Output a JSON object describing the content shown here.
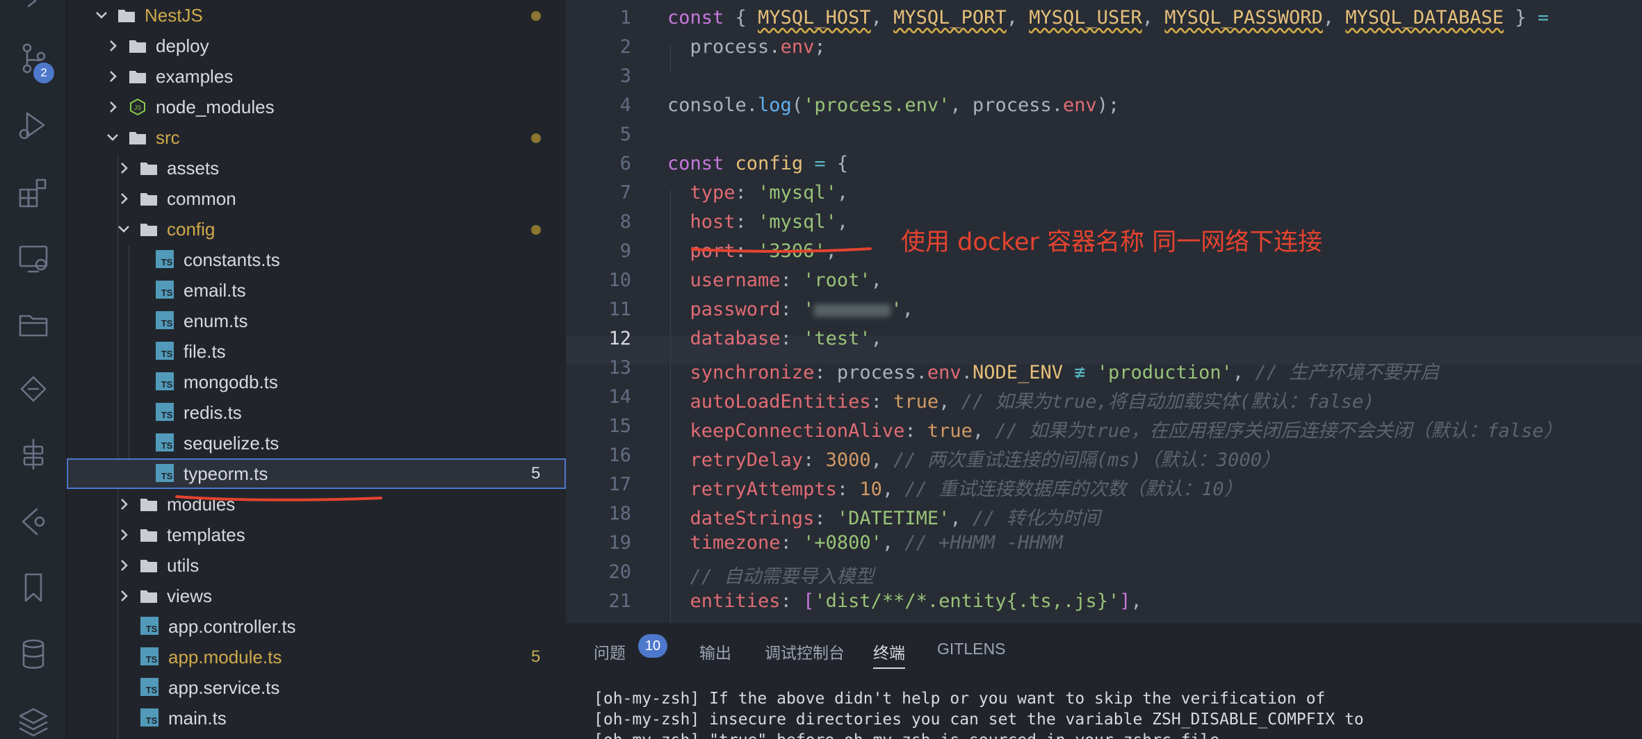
{
  "activity_bar": {
    "scm_badge": "2"
  },
  "explorer": {
    "tree": [
      {
        "label": "NestJS",
        "kind": "folder-open",
        "depth": 0,
        "modified": true,
        "mark": "dot"
      },
      {
        "label": "deploy",
        "kind": "folder",
        "depth": 1
      },
      {
        "label": "examples",
        "kind": "folder",
        "depth": 1
      },
      {
        "label": "node_modules",
        "kind": "node",
        "depth": 1
      },
      {
        "label": "src",
        "kind": "folder-open",
        "depth": 1,
        "modified": true,
        "mark": "dot"
      },
      {
        "label": "assets",
        "kind": "folder",
        "depth": 2
      },
      {
        "label": "common",
        "kind": "folder",
        "depth": 2
      },
      {
        "label": "config",
        "kind": "folder-open",
        "depth": 2,
        "modified": true,
        "mark": "dot"
      },
      {
        "label": "constants.ts",
        "kind": "ts",
        "depth": 3
      },
      {
        "label": "email.ts",
        "kind": "ts",
        "depth": 3
      },
      {
        "label": "enum.ts",
        "kind": "ts",
        "depth": 3
      },
      {
        "label": "file.ts",
        "kind": "ts",
        "depth": 3
      },
      {
        "label": "mongodb.ts",
        "kind": "ts",
        "depth": 3
      },
      {
        "label": "redis.ts",
        "kind": "ts",
        "depth": 3
      },
      {
        "label": "sequelize.ts",
        "kind": "ts",
        "depth": 3
      },
      {
        "label": "typeorm.ts",
        "kind": "ts",
        "depth": 3,
        "selected": true,
        "count": "5"
      },
      {
        "label": "modules",
        "kind": "folder",
        "depth": 2
      },
      {
        "label": "templates",
        "kind": "folder",
        "depth": 2
      },
      {
        "label": "utils",
        "kind": "folder",
        "depth": 2
      },
      {
        "label": "views",
        "kind": "folder",
        "depth": 2
      },
      {
        "label": "app.controller.ts",
        "kind": "ts",
        "depth": 2
      },
      {
        "label": "app.module.ts",
        "kind": "ts",
        "depth": 2,
        "modified": true,
        "count": "5"
      },
      {
        "label": "app.service.ts",
        "kind": "ts",
        "depth": 2
      },
      {
        "label": "main.ts",
        "kind": "ts",
        "depth": 2
      }
    ]
  },
  "editor": {
    "current_line": 12,
    "lines": [
      {
        "n": "1",
        "t": [
          [
            "k",
            "const "
          ],
          [
            "w",
            "{ "
          ],
          [
            "v squig",
            "MYSQL_HOST"
          ],
          [
            "w",
            ", "
          ],
          [
            "v squig",
            "MYSQL_PORT"
          ],
          [
            "w",
            ", "
          ],
          [
            "v squig",
            "MYSQL_USER"
          ],
          [
            "w",
            ", "
          ],
          [
            "v squig",
            "MYSQL_PASSWORD"
          ],
          [
            "w",
            ", "
          ],
          [
            "v squig",
            "MYSQL_DATABASE"
          ],
          [
            "w",
            " } "
          ],
          [
            "o",
            "="
          ]
        ]
      },
      {
        "n": "2",
        "t": [
          [
            "w",
            "  process."
          ],
          [
            "p",
            "env"
          ],
          [
            "w",
            ";"
          ]
        ]
      },
      {
        "n": "3",
        "t": []
      },
      {
        "n": "4",
        "t": [
          [
            "w",
            "console."
          ],
          [
            "f",
            "log"
          ],
          [
            "w",
            "("
          ],
          [
            "s",
            "'process.env'"
          ],
          [
            "w",
            ", process."
          ],
          [
            "p",
            "env"
          ],
          [
            "w",
            ");"
          ]
        ]
      },
      {
        "n": "5",
        "t": []
      },
      {
        "n": "6",
        "t": [
          [
            "k",
            "const "
          ],
          [
            "v",
            "config"
          ],
          [
            "o",
            " = "
          ],
          [
            "w",
            "{"
          ]
        ]
      },
      {
        "n": "7",
        "t": [
          [
            "p",
            "  type"
          ],
          [
            "w",
            ": "
          ],
          [
            "s",
            "'mysql'"
          ],
          [
            "w",
            ","
          ]
        ]
      },
      {
        "n": "8",
        "t": [
          [
            "p",
            "  host"
          ],
          [
            "w",
            ": "
          ],
          [
            "s",
            "'mysql'"
          ],
          [
            "w",
            ","
          ]
        ]
      },
      {
        "n": "9",
        "t": [
          [
            "p",
            "  port"
          ],
          [
            "w",
            ": "
          ],
          [
            "s",
            "'3306'"
          ],
          [
            "w",
            ","
          ]
        ]
      },
      {
        "n": "10",
        "t": [
          [
            "p",
            "  username"
          ],
          [
            "w",
            ": "
          ],
          [
            "s",
            "'root'"
          ],
          [
            "w",
            ","
          ]
        ]
      },
      {
        "n": "11",
        "t": [
          [
            "p",
            "  password"
          ],
          [
            "w",
            ": "
          ],
          [
            "s",
            "'"
          ],
          [
            "blur",
            ""
          ],
          [
            "s",
            "'"
          ],
          [
            "w",
            ","
          ]
        ]
      },
      {
        "n": "12",
        "t": [
          [
            "p",
            "  database"
          ],
          [
            "w",
            ": "
          ],
          [
            "s",
            "'test'"
          ],
          [
            "w",
            ","
          ]
        ]
      },
      {
        "n": "13",
        "t": [
          [
            "p",
            "  synchronize"
          ],
          [
            "w",
            ": process."
          ],
          [
            "p",
            "env"
          ],
          [
            "w",
            "."
          ],
          [
            "v",
            "NODE_ENV"
          ],
          [
            "o",
            " ≢ "
          ],
          [
            "s",
            "'production'"
          ],
          [
            "w",
            ", "
          ],
          [
            "c",
            "// 生产环境不要开启"
          ]
        ]
      },
      {
        "n": "14",
        "t": [
          [
            "p",
            "  autoLoadEntities"
          ],
          [
            "w",
            ": "
          ],
          [
            "n",
            "true"
          ],
          [
            "w",
            ", "
          ],
          [
            "c",
            "// 如果为true,将自动加载实体(默认：false)"
          ]
        ]
      },
      {
        "n": "15",
        "t": [
          [
            "p",
            "  keepConnectionAlive"
          ],
          [
            "w",
            ": "
          ],
          [
            "n",
            "true"
          ],
          [
            "w",
            ", "
          ],
          [
            "c",
            "// 如果为true，在应用程序关闭后连接不会关闭（默认：false）"
          ]
        ]
      },
      {
        "n": "16",
        "t": [
          [
            "p",
            "  retryDelay"
          ],
          [
            "w",
            ": "
          ],
          [
            "n",
            "3000"
          ],
          [
            "w",
            ", "
          ],
          [
            "c",
            "// 两次重试连接的间隔(ms)（默认：3000）"
          ]
        ]
      },
      {
        "n": "17",
        "t": [
          [
            "p",
            "  retryAttempts"
          ],
          [
            "w",
            ": "
          ],
          [
            "n",
            "10"
          ],
          [
            "w",
            ", "
          ],
          [
            "c",
            "// 重试连接数据库的次数（默认：10）"
          ]
        ]
      },
      {
        "n": "18",
        "t": [
          [
            "p",
            "  dateStrings"
          ],
          [
            "w",
            ": "
          ],
          [
            "s",
            "'DATETIME'"
          ],
          [
            "w",
            ", "
          ],
          [
            "c",
            "// 转化为时间"
          ]
        ]
      },
      {
        "n": "19",
        "t": [
          [
            "p",
            "  timezone"
          ],
          [
            "w",
            ": "
          ],
          [
            "s",
            "'+0800'"
          ],
          [
            "w",
            ", "
          ],
          [
            "c",
            "// +HHMM -HHMM"
          ]
        ]
      },
      {
        "n": "20",
        "t": [
          [
            "c",
            "  // 自动需要导入模型"
          ]
        ]
      },
      {
        "n": "21",
        "t": [
          [
            "p",
            "  entities"
          ],
          [
            "w",
            ": "
          ],
          [
            "k",
            "["
          ],
          [
            "s",
            "'dist/**/*.entity{.ts,.js}'"
          ],
          [
            "k",
            "]"
          ],
          [
            "w",
            ","
          ]
        ]
      }
    ],
    "annotation": "使用 docker 容器名称 同一网络下连接"
  },
  "panel": {
    "tabs": [
      {
        "label": "问题",
        "badge": "10"
      },
      {
        "label": "输出"
      },
      {
        "label": "调试控制台"
      },
      {
        "label": "终端",
        "active": true
      },
      {
        "label": "GITLENS"
      }
    ],
    "terminal_lines": [
      "[oh-my-zsh] If the above didn't help or you want to skip the verification of",
      "[oh-my-zsh] insecure directories you can set the variable ZSH_DISABLE_COMPFIX to",
      "[oh-my-zsh] \"true\" before oh-my-zsh is sourced in your zshrc file."
    ]
  },
  "colors": {
    "accent": "#4d78cc",
    "annotation": "#e5432f",
    "modified": "#d0a94a"
  }
}
